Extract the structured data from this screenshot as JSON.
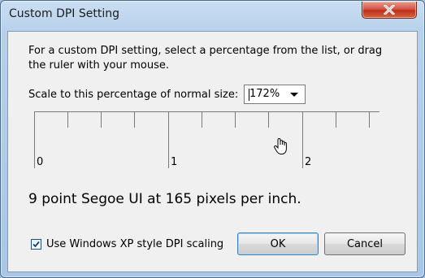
{
  "window": {
    "title": "Custom DPI Setting",
    "close_icon": "close-icon"
  },
  "dialog": {
    "instructions": "For a custom DPI setting, select a percentage from the list, or drag the ruler with your mouse.",
    "scale_label": "Scale to this percentage of normal size:",
    "scale_value": "172%",
    "ruler_labels": [
      "0",
      "1",
      "2"
    ],
    "sample_text": "9 point Segoe UI at 165 pixels per inch.",
    "checkbox_label": "Use Windows XP style DPI scaling",
    "checkbox_checked": true,
    "ok_label": "OK",
    "cancel_label": "Cancel"
  }
}
